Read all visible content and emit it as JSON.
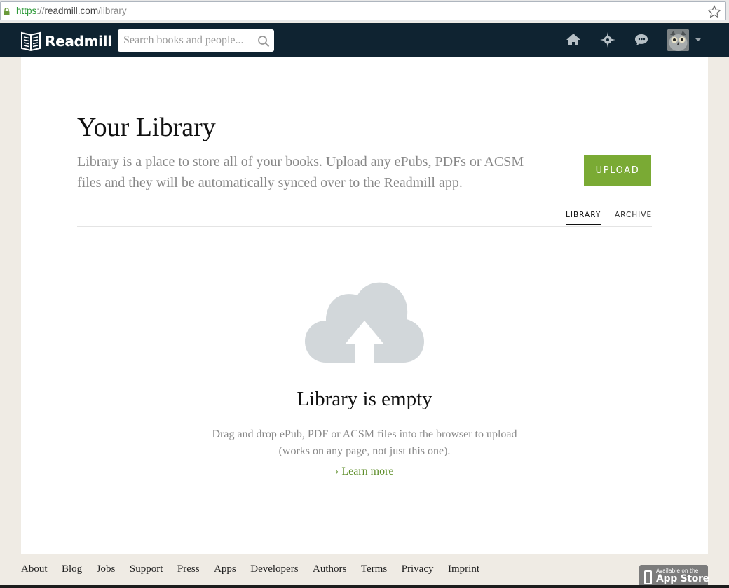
{
  "browser": {
    "url_scheme": "https",
    "url_separator": "://",
    "url_host": "readmill.com",
    "url_path": "/library"
  },
  "nav": {
    "brand": "Readmill",
    "search_placeholder": "Search books and people...",
    "icons": [
      "home-icon",
      "explore-compass-icon",
      "messages-icon",
      "avatar",
      "chevron-down-icon"
    ],
    "bg_color": "#0f2331"
  },
  "main": {
    "title": "Your Library",
    "description": "Library is a place to store all of your books. Upload any ePubs, PDFs or ACSM files and they will be automatically synced over to the Readmill app.",
    "upload_label": "UPLOAD",
    "upload_color": "#7aaa34",
    "tabs": [
      {
        "label": "LIBRARY",
        "active": true
      },
      {
        "label": "ARCHIVE",
        "active": false
      }
    ],
    "empty": {
      "icon": "cloud-upload-icon",
      "title": "Library is empty",
      "line1": "Drag and drop ePub, PDF or ACSM files into the browser to upload",
      "line2": "(works on any page, not just this one).",
      "learn_more": "Learn more"
    }
  },
  "footer": {
    "links": [
      "About",
      "Blog",
      "Jobs",
      "Support",
      "Press",
      "Apps",
      "Developers",
      "Authors",
      "Terms",
      "Privacy",
      "Imprint"
    ],
    "appstore_small": "Available on the",
    "appstore_big": "App Store"
  }
}
